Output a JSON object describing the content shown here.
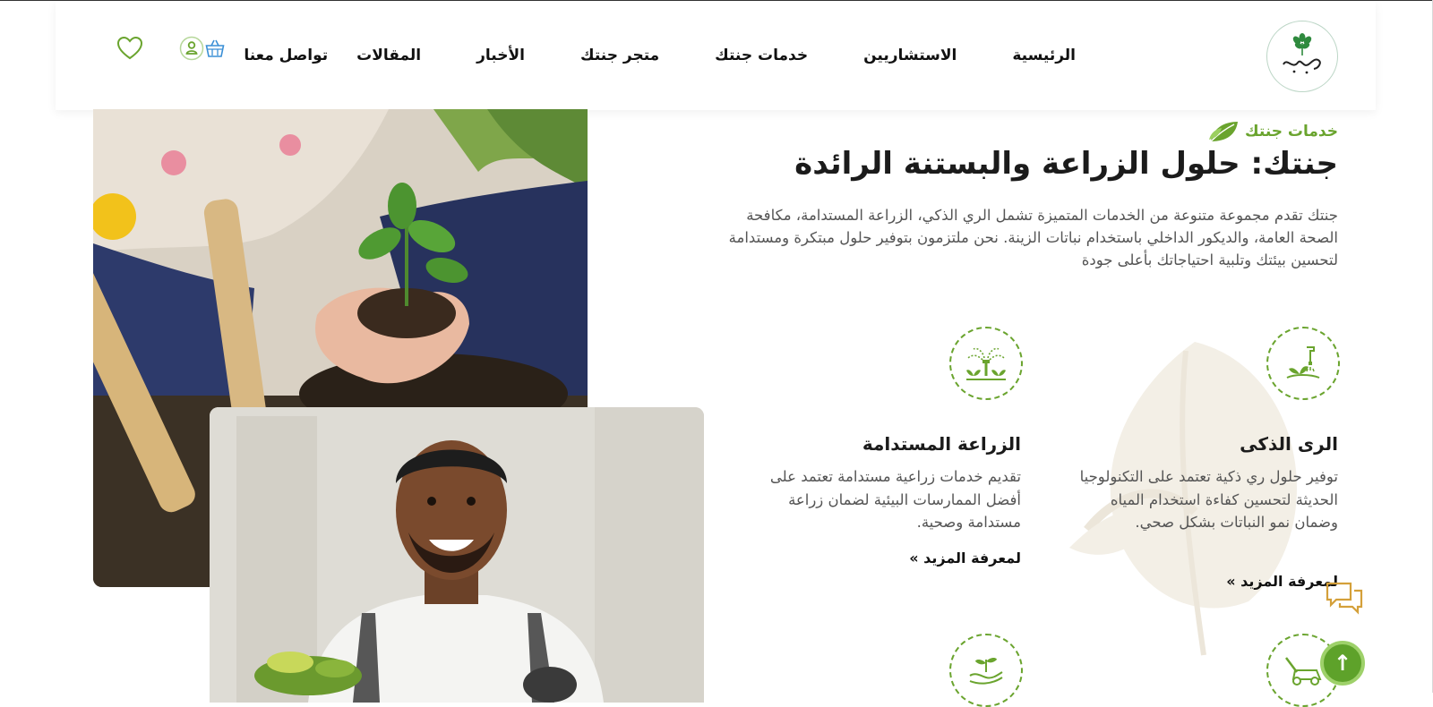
{
  "brand": {
    "logo_text": "جنتك"
  },
  "nav": {
    "items": [
      {
        "label": "الرئيسية"
      },
      {
        "label": "الاستشاريين"
      },
      {
        "label": "خدمات جنتك"
      },
      {
        "label": "متجر جنتك"
      },
      {
        "label": "الأخبار"
      },
      {
        "label": "المقالات"
      },
      {
        "label": "تواصل معنا"
      }
    ]
  },
  "header_icons": [
    "heart-icon",
    "user-icon",
    "basket-icon"
  ],
  "section": {
    "label": "خدمات جنتك",
    "title": "جنتك: حلول الزراعة والبستنة الرائدة",
    "description": "جنتك تقدم مجموعة متنوعة من الخدمات المتميزة تشمل الري الذكي، الزراعة المستدامة، مكافحة الصحة العامة، والديكور الداخلي باستخدام نباتات الزينة. نحن ملتزمون بتوفير حلول مبتكرة ومستدامة لتحسين بيئتك وتلبية احتياجاتك بأعلى جودة"
  },
  "services": [
    {
      "title": "الرى الذكى",
      "description": "توفير حلول ري ذكية تعتمد على التكنولوجيا الحديثة لتحسين كفاءة استخدام المياه وضمان نمو النباتات بشكل صحي.",
      "more": "لمعرفة المزيد »",
      "icon": "watering-icon"
    },
    {
      "title": "الزراعة المستدامة",
      "description": "تقديم خدمات زراعية مستدامة تعتمد على أفضل الممارسات البيئية لضمان زراعة مستدامة وصحية.",
      "more": "لمعرفة المزيد »",
      "icon": "sprinkler-icon"
    }
  ],
  "colors": {
    "accent": "#6aa42e",
    "top_button": "#5ea22a",
    "chat": "#d4a03a",
    "basket": "#3a8fd6"
  }
}
